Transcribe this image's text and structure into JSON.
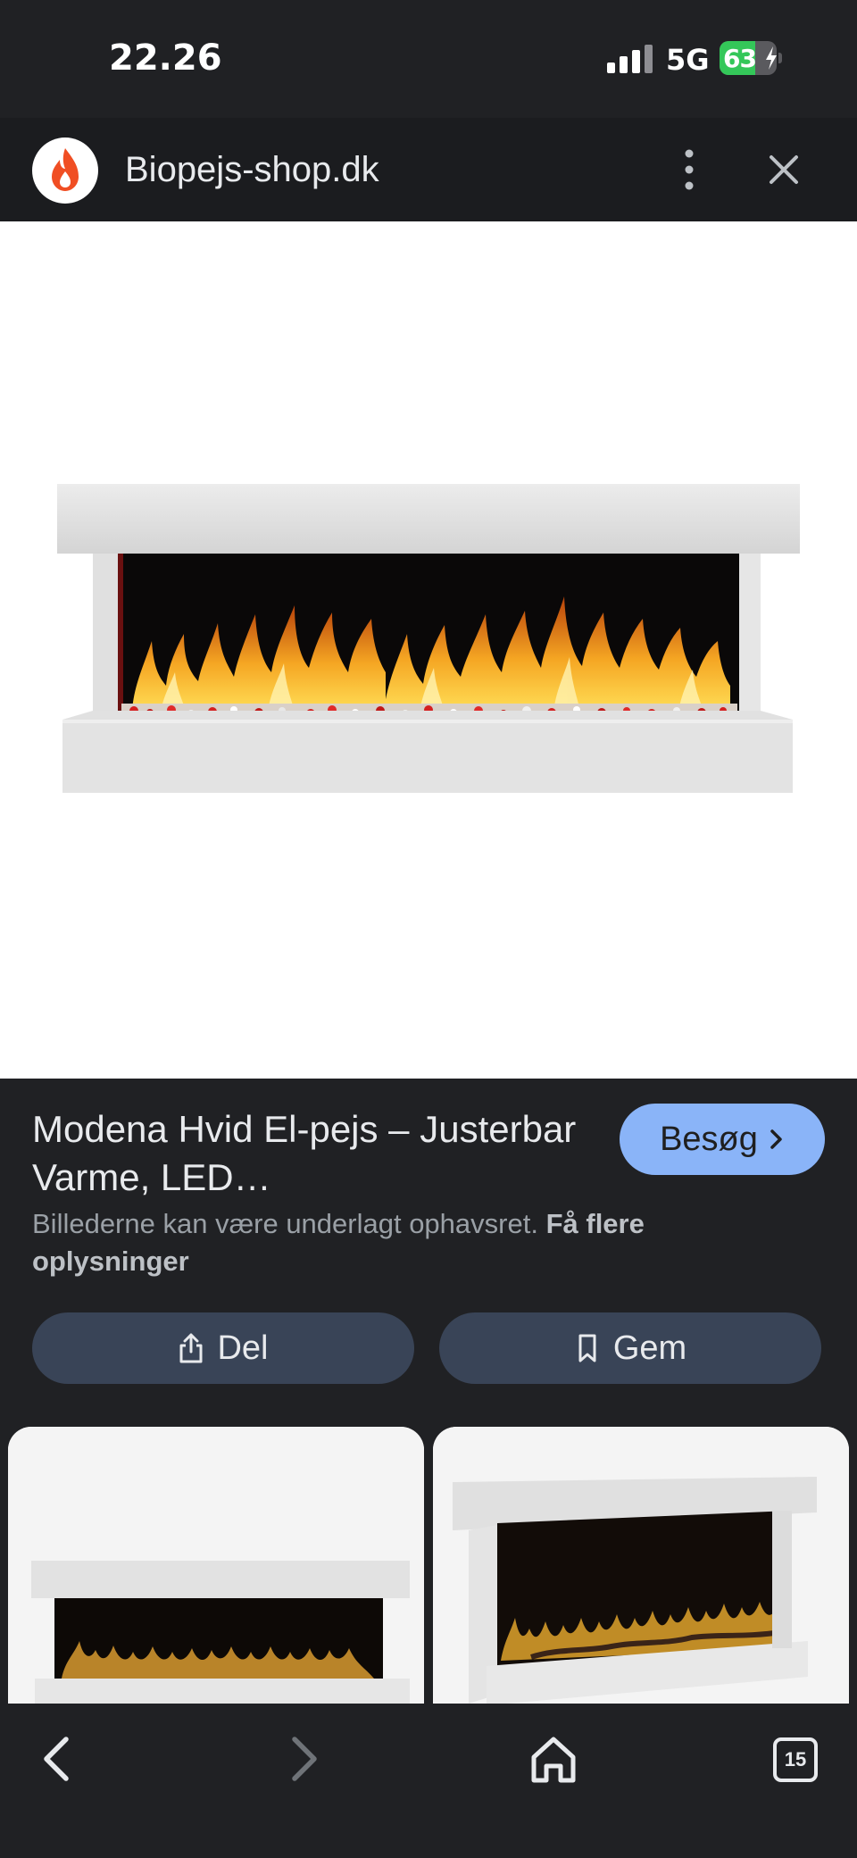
{
  "status_bar": {
    "time": "22.26",
    "network": "5G",
    "battery_percent": "63",
    "battery_level": 0.63,
    "signal_bars": 3
  },
  "header": {
    "site_name": "Biopejs-shop.dk",
    "logo_icon": "flame-icon",
    "menu_icon": "more-vert-icon",
    "close_icon": "close-icon"
  },
  "product": {
    "title": "Modena Hvid El-pejs – Justerbar Varme, LED…",
    "visit_label": "Besøg",
    "copyright_text": "Billederne kan være underlagt ophavsret.",
    "copyright_link": "Få flere oplysninger"
  },
  "actions": {
    "share_label": "Del",
    "save_label": "Gem"
  },
  "bottom_nav": {
    "tab_count": "15"
  },
  "colors": {
    "accent": "#8ab4f8",
    "background": "#202124",
    "button_bg": "#394457",
    "battery_green": "#34c759",
    "logo_orange": "#f04e23"
  }
}
